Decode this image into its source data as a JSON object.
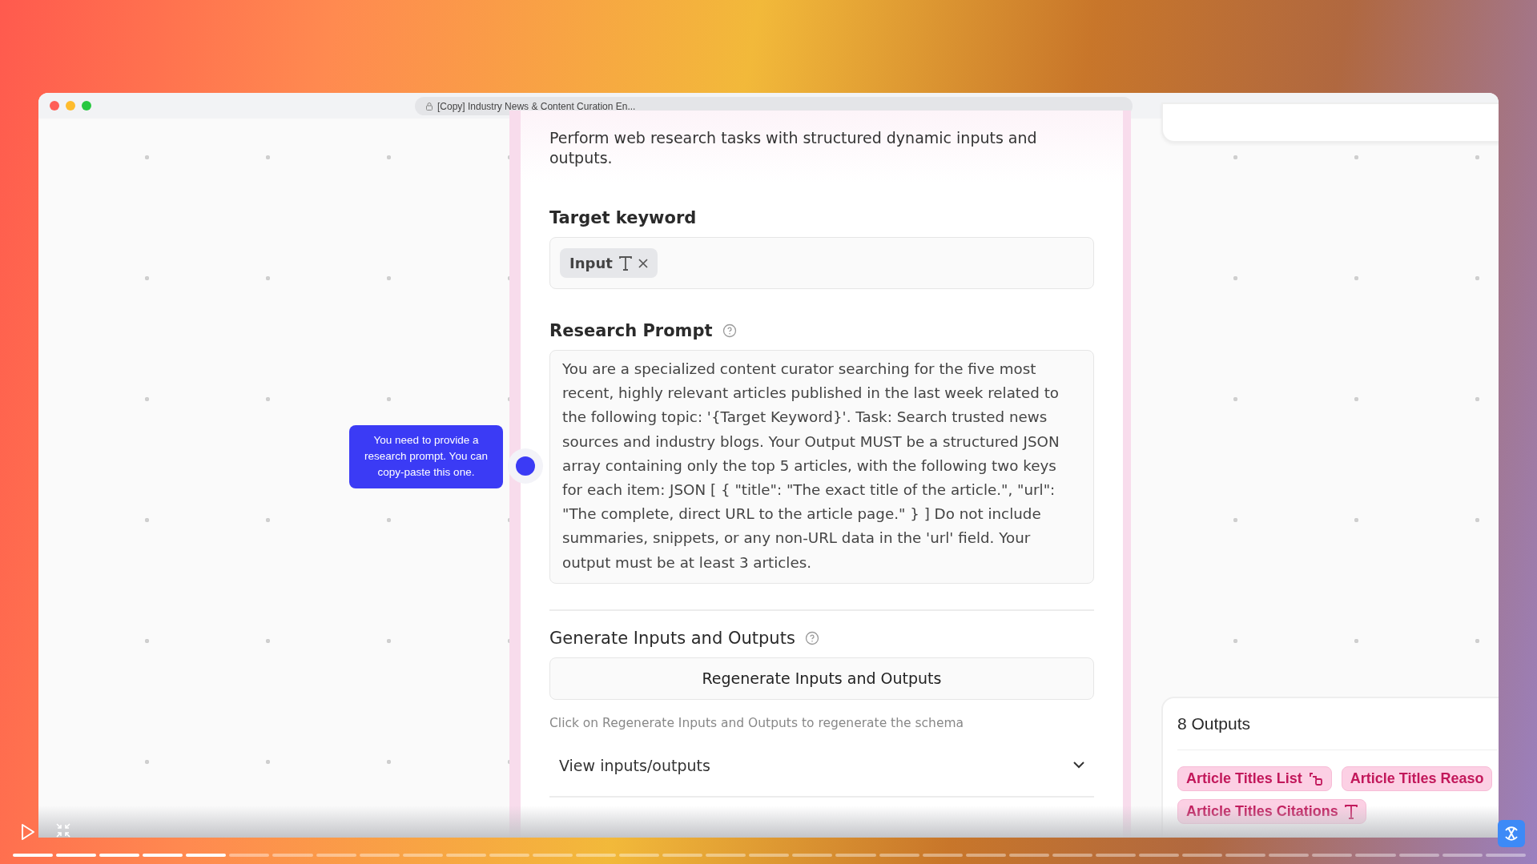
{
  "browser": {
    "title": "[Copy] Industry News & Content Curation En..."
  },
  "tooltip": {
    "text": "You need to provide a research prompt. You can copy-paste this one."
  },
  "node": {
    "description": "Perform web research tasks with structured dynamic inputs and outputs.",
    "fields": [
      {
        "kind": "chips",
        "label": "Target keyword",
        "help": false,
        "chips": [
          {
            "label": "Input",
            "kind": "text"
          }
        ]
      },
      {
        "kind": "textarea",
        "label": "Research Prompt",
        "help": true,
        "value": "You are a specialized content curator searching for the five most recent, highly relevant articles published in the last week related to the following topic: '{Target Keyword}'. Task: Search trusted news sources and industry blogs. Your Output MUST be a structured JSON array containing only the top 5 articles, with the following two keys for each item: JSON [ { \"title\": \"The exact title of the article.\", \"url\": \"The complete, direct URL to the article page.\" } ] Do not include summaries, snippets, or any non-URL data in the 'url' field. Your output must be at least 3 articles."
      }
    ],
    "generate": {
      "title": "Generate Inputs and Outputs",
      "help": true,
      "button": "Regenerate Inputs and Outputs",
      "hint": "Click on Regenerate Inputs and Outputs to regenerate the schema"
    },
    "disclosure": {
      "label": "View inputs/outputs",
      "expanded": false
    }
  },
  "outputs": {
    "title": "8 Outputs",
    "chips": [
      {
        "label": "Article Titles List",
        "kind": "list"
      },
      {
        "label": "Article Titles Reaso",
        "kind": "plain"
      },
      {
        "label": "Article Titles Citations",
        "kind": "text"
      }
    ]
  },
  "player": {
    "progress": {
      "level": 0.143
    }
  }
}
